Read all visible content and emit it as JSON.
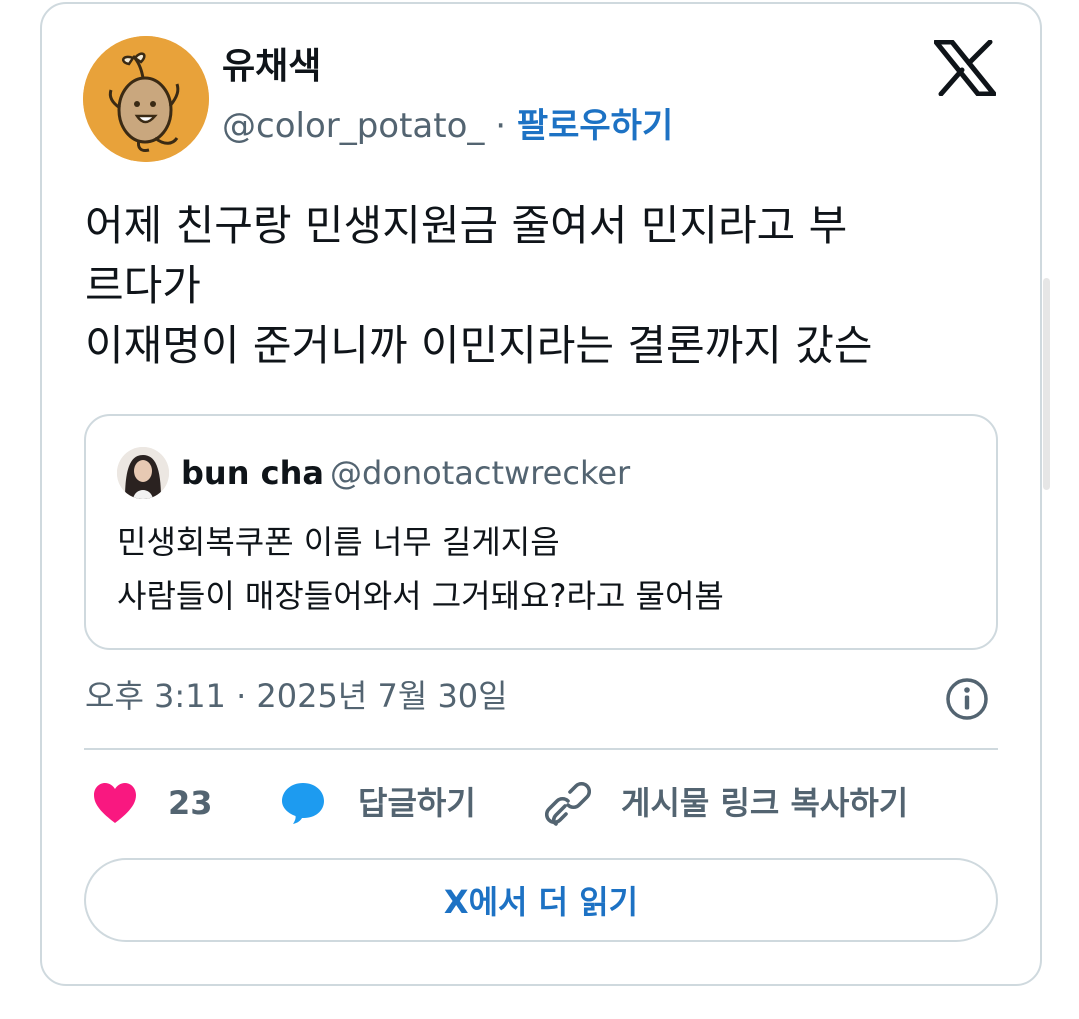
{
  "author": {
    "display_name": "유채색",
    "handle": "@color_potato_",
    "separator": "·",
    "follow_label": "팔로우하기",
    "avatar_icon": "potato-character-icon",
    "avatar_color": "#e8a23a"
  },
  "platform_logo": "x-logo-icon",
  "tweet": {
    "lines": [
      "어제 친구랑 민생지원금 줄여서 민지라고 부",
      "르다가",
      "이재명이 준거니까 이민지라는 결론까지 갔슨"
    ]
  },
  "quoted_tweet": {
    "display_name": "bun cha",
    "handle": "@donotactwrecker",
    "lines": [
      "민생회복쿠폰 이름 너무 길게지음",
      "사람들이 매장들어와서 그거돼요?라고 물어봄"
    ]
  },
  "timestamp": "오후 3:11 · 2025년 7월 30일",
  "actions": {
    "like_count": "23",
    "reply_label": "답글하기",
    "copy_link_label": "게시물 링크 복사하기"
  },
  "read_more_label": "X에서 더 읽기",
  "colors": {
    "accent": "#1d72c4",
    "like": "#f91880",
    "reply": "#1d9bf0",
    "muted": "#536471",
    "border": "#cfd9de"
  }
}
